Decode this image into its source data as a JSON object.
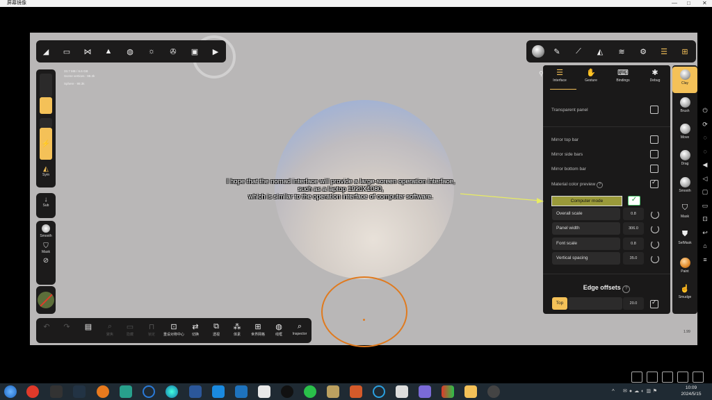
{
  "window": {
    "title": "屏幕镜像",
    "controls": [
      "—",
      "□",
      "✕"
    ]
  },
  "stats": {
    "line1": "33.7 MB / 6.6 GB",
    "line2": "Scene vertices : 98.3k",
    "object": "Sphere",
    "object_vertices": "98.3k"
  },
  "top_toolbar": {
    "icons": [
      "scene-icon",
      "folder-icon",
      "nodes-icon",
      "pyramid-icon",
      "grid-sphere-icon",
      "sun-icon",
      "film-reel-icon",
      "image-icon",
      "camera-icon"
    ]
  },
  "right_toolbar": {
    "icons": [
      "material-ball-icon",
      "brush-stroke-icon",
      "eyedropper-icon",
      "triangle-icon",
      "layers-icon",
      "settings-icon",
      "sliders-icon",
      "tools-icon"
    ]
  },
  "left_bar": {
    "sym_label": "Sym",
    "sub_label": "Sub",
    "smooth_label": "Smooth",
    "mask_label": "Mask"
  },
  "bottom_toolbar": {
    "items": [
      {
        "label": "",
        "icon": "undo-icon"
      },
      {
        "label": "",
        "icon": "redo-icon"
      },
      {
        "label": "",
        "icon": "doc-icon"
      },
      {
        "label": "聚焦",
        "icon": "search-icon"
      },
      {
        "label": "隐藏",
        "icon": "hide-icon"
      },
      {
        "label": "锁定",
        "icon": "lock-icon"
      },
      {
        "label": "重设对称中心",
        "icon": "center-icon"
      },
      {
        "label": "切换",
        "icon": "switch-icon"
      },
      {
        "label": "透视",
        "icon": "perspective-icon"
      },
      {
        "label": "体素",
        "icon": "voxel-icon"
      },
      {
        "label": "世界网格",
        "icon": "world-grid-icon"
      },
      {
        "label": "线框",
        "icon": "wireframe-icon"
      },
      {
        "label": "Inspector",
        "icon": "inspector-icon"
      }
    ]
  },
  "settings": {
    "tabs": [
      "Interface",
      "Gesture",
      "Bindings",
      "Debug"
    ],
    "transparent_panel": "Transparent panel",
    "mirror_top": "Mirror top bar",
    "mirror_side": "Mirror side bars",
    "mirror_bottom": "Mirror bottom bar",
    "material_color_preview": "Material color preview",
    "computer_mode": "Computer mode",
    "overall_scale": {
      "label": "Overall scale",
      "value": "0.8"
    },
    "panel_width": {
      "label": "Panel width",
      "value": "306.0"
    },
    "font_scale": {
      "label": "Font scale",
      "value": "0.8"
    },
    "vertical_spacing": {
      "label": "Vertical spacing",
      "value": "35.0"
    },
    "edge_offsets": "Edge offsets",
    "top": {
      "label": "Top",
      "value": "20.0"
    },
    "checks": {
      "transparent_panel": false,
      "mirror_top": false,
      "mirror_side": false,
      "mirror_bottom": false,
      "material_color_preview": true,
      "computer_mode": true,
      "top": true
    }
  },
  "tools": [
    "Clay",
    "Brush",
    "Move",
    "Drag",
    "Smooth",
    "Mask",
    "SelMask",
    "Paint",
    "Smudge"
  ],
  "fps": "1.99",
  "annotation": {
    "line1": "I hope that the nomad interface will provide a large-screen operation interface,",
    "line2": "such as a laptop 1920X1080,",
    "line3": "which is similar to the operation interface of computer software."
  },
  "taskbar": {
    "time": "10:09",
    "date": "2024/5/15"
  },
  "colors": {
    "accent": "#f4c158",
    "computer_mode_bg": "#9a9a3a",
    "annotation_arrow": "#e8ec63",
    "viewport": "#b9b7b7"
  }
}
